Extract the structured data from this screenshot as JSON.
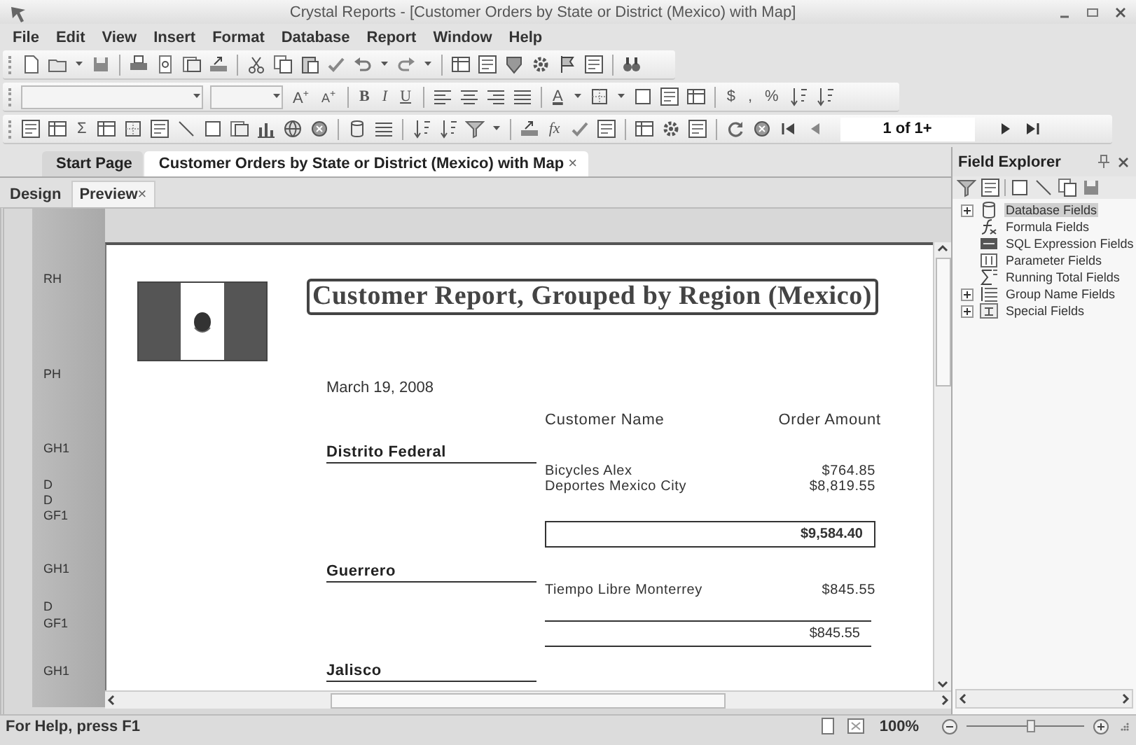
{
  "window": {
    "title": "Crystal Reports - [Customer Orders by State or District (Mexico) with Map]"
  },
  "menu": [
    "File",
    "Edit",
    "View",
    "Insert",
    "Format",
    "Database",
    "Report",
    "Window",
    "Help"
  ],
  "format_toolbar": {
    "buttons": [
      {
        "label": "A$^{+}$",
        "kind": "grow"
      },
      {
        "label": "A$^{+}$",
        "kind": "shrink"
      },
      {
        "label": "B",
        "kind": "bold"
      },
      {
        "label": "I",
        "kind": "italic"
      },
      {
        "label": "U",
        "kind": "underline"
      },
      {
        "label": "A",
        "kind": "color"
      },
      {
        "label": "$",
        "kind": "plain"
      },
      {
        "label": ",",
        "kind": "plain"
      },
      {
        "label": "%",
        "kind": "plain"
      }
    ]
  },
  "insert_toolbar": {
    "buttons": [
      {
        "label": "Σ",
        "kind": "plain"
      },
      {
        "label": "fx",
        "kind": "italic"
      }
    ],
    "page_field": {
      "value": "1 of 1+"
    }
  },
  "document_tabs": [
    {
      "label": "Start Page",
      "selected": false
    },
    {
      "label": "Customer Orders by State or District (Mexico) with Map",
      "selected": true,
      "close": "×"
    }
  ],
  "view_tabs": [
    {
      "label": "Design",
      "selected": false
    },
    {
      "label": "Preview",
      "selected": true,
      "close": "×"
    }
  ],
  "section_gutter": [
    {
      "label": "RH"
    },
    {
      "label": "PH"
    },
    {
      "label": "GH1"
    },
    {
      "label": "D"
    },
    {
      "label": "D"
    },
    {
      "label": "GF1"
    },
    {
      "label": "GH1"
    },
    {
      "label": "D"
    },
    {
      "label": "GF1"
    },
    {
      "label": "GH1"
    }
  ],
  "report": {
    "title": "Customer Report, Grouped by Region (Mexico)",
    "date": "March 19, 2008",
    "columns": [
      "Customer Name",
      "Order Amount"
    ],
    "groups": [
      {
        "name": "Distrito Federal",
        "rows": [
          {
            "customer": "Bicycles Alex",
            "amount": "$764.85"
          },
          {
            "customer": "Deportes Mexico City",
            "amount": "$8,819.55"
          }
        ],
        "total": {
          "value": "$9,584.40",
          "kind": "boxed"
        }
      },
      {
        "name": "Guerrero",
        "rows": [
          {
            "customer": "Tiempo Libre Monterrey",
            "amount": "$845.55"
          }
        ],
        "total": {
          "value": "$845.55",
          "kind": "ruled"
        }
      },
      {
        "name": "Jalisco"
      }
    ]
  },
  "field_explorer": {
    "title": "Field Explorer",
    "items": [
      {
        "label": "Database Fields",
        "kind": "database",
        "expandable": true,
        "selected": true
      },
      {
        "label": "Formula Fields",
        "kind": "formula",
        "expandable": false,
        "selected": false
      },
      {
        "label": "SQL Expression Fields",
        "kind": "sql",
        "expandable": false,
        "selected": false
      },
      {
        "label": "Parameter Fields",
        "kind": "parameter",
        "expandable": false,
        "selected": false
      },
      {
        "label": "Running Total Fields",
        "kind": "running_total",
        "expandable": false,
        "selected": false
      },
      {
        "label": "Group Name Fields",
        "kind": "group_name",
        "expandable": true,
        "selected": false
      },
      {
        "label": "Special Fields",
        "kind": "special",
        "expandable": true,
        "selected": false
      }
    ]
  },
  "status_bar": {
    "text": "For Help, press F1",
    "zoom": "100%",
    "zoom_slider": {
      "level": 0.55
    }
  }
}
